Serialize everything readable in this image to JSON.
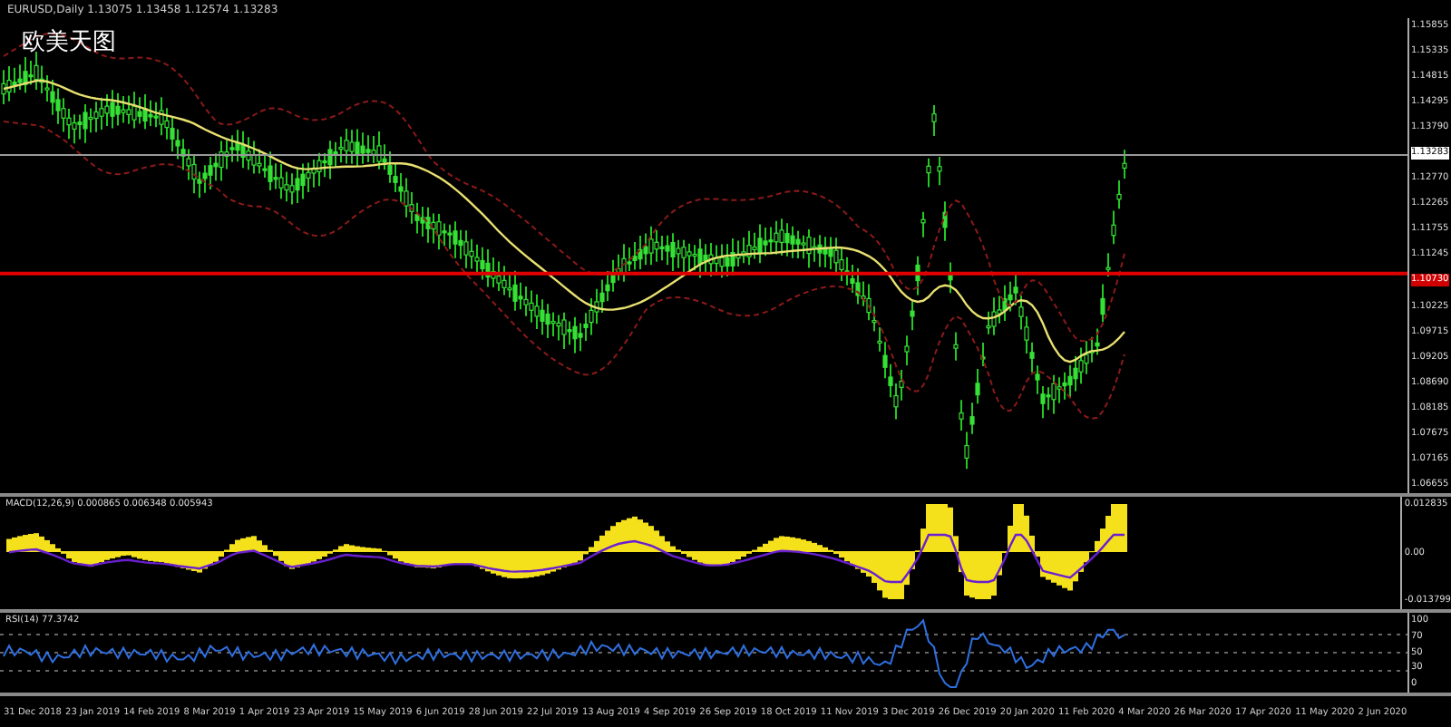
{
  "chart_header": "EURUSD,Daily  1.13075 1.13458 1.12574 1.13283",
  "caption": "欧美天图",
  "price_axis": [
    {
      "label": "1.15855",
      "kind": "tick"
    },
    {
      "label": "1.15335",
      "kind": "tick"
    },
    {
      "label": "1.14815",
      "kind": "tick"
    },
    {
      "label": "1.14295",
      "kind": "tick"
    },
    {
      "label": "1.13790",
      "kind": "tick"
    },
    {
      "label": "1.13283",
      "kind": "current"
    },
    {
      "label": "1.12770",
      "kind": "tick"
    },
    {
      "label": "1.12265",
      "kind": "tick"
    },
    {
      "label": "1.11755",
      "kind": "tick"
    },
    {
      "label": "1.11245",
      "kind": "tick"
    },
    {
      "label": "1.10730",
      "kind": "level"
    },
    {
      "label": "1.10225",
      "kind": "tick"
    },
    {
      "label": "1.09715",
      "kind": "tick"
    },
    {
      "label": "1.09205",
      "kind": "tick"
    },
    {
      "label": "1.08690",
      "kind": "tick"
    },
    {
      "label": "1.08185",
      "kind": "tick"
    },
    {
      "label": "1.07675",
      "kind": "tick"
    },
    {
      "label": "1.07165",
      "kind": "tick"
    },
    {
      "label": "1.06655",
      "kind": "tick"
    }
  ],
  "macd": {
    "label": "MACD(12,26,9) 0.000865 0.006348 0.005943",
    "axis": [
      "0.012835",
      "0.00",
      "-0.013799"
    ]
  },
  "rsi": {
    "label": "RSI(14) 77.3742",
    "axis": [
      "100",
      "70",
      "50",
      "30",
      "0"
    ]
  },
  "date_axis": [
    "31 Dec 2018",
    "23 Jan 2019",
    "14 Feb 2019",
    "8 Mar 2019",
    "1 Apr 2019",
    "23 Apr 2019",
    "15 May 2019",
    "6 Jun 2019",
    "28 Jun 2019",
    "22 Jul 2019",
    "13 Aug 2019",
    "4 Sep 2019",
    "26 Sep 2019",
    "18 Oct 2019",
    "11 Nov 2019",
    "3 Dec 2019",
    "26 Dec 2019",
    "20 Jan 2020",
    "11 Feb 2020",
    "4 Mar 2020",
    "26 Mar 2020",
    "17 Apr 2020",
    "11 May 2020",
    "2 Jun 2020"
  ]
}
